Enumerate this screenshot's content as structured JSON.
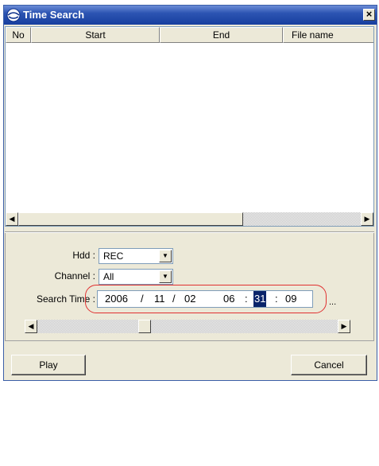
{
  "window": {
    "title": "Time Search",
    "close_glyph": "×"
  },
  "list": {
    "columns": [
      "No",
      "Start",
      "End",
      "File name"
    ],
    "rows": []
  },
  "form": {
    "hdd_label": "Hdd :",
    "hdd_value": "REC",
    "channel_label": "Channel :",
    "channel_value": "All",
    "search_time_label": "Search Time :",
    "search_time": {
      "year": "2006",
      "month": "11",
      "day": "02",
      "hour": "06",
      "minute": "31",
      "second": "09",
      "date_sep": "/",
      "time_sep": ":"
    },
    "more_glyph": "..."
  },
  "slider": {
    "position_fraction": 0.35
  },
  "buttons": {
    "play": "Play",
    "cancel": "Cancel"
  },
  "icons": {
    "title": "app-globe-icon",
    "scroll_left": "arrow-left-icon",
    "scroll_right": "arrow-right-icon",
    "dropdown": "chevron-down-icon"
  },
  "colors": {
    "titlebar": "#2c54b2",
    "highlight": "#0a246a",
    "annotation_ring": "#e03030",
    "face": "#ece9d8"
  }
}
